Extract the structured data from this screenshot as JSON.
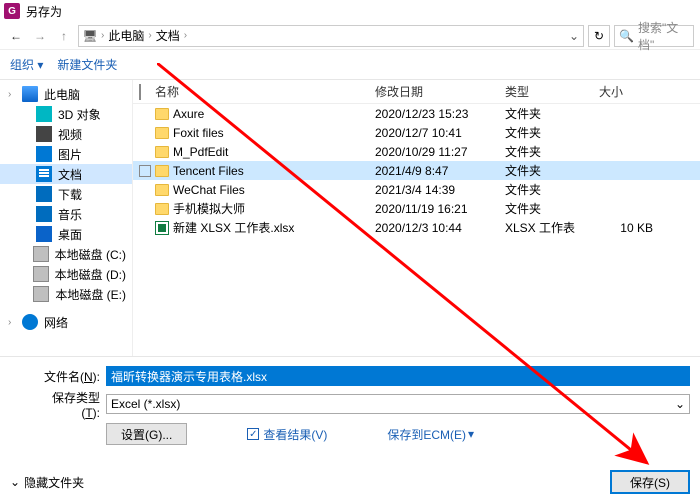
{
  "title": "另存为",
  "breadcrumb": {
    "root": "此电脑",
    "folder": "文档"
  },
  "search_placeholder": "搜索\"文档\"",
  "toolbar": {
    "organize": "组织 ▾",
    "newfolder": "新建文件夹"
  },
  "sidebar": [
    {
      "label": "此电脑",
      "icon": "i-pc",
      "sel": false,
      "indent": 8,
      "chevron": true
    },
    {
      "label": "3D 对象",
      "icon": "i-3d",
      "sel": false,
      "indent": 22
    },
    {
      "label": "视频",
      "icon": "i-vid",
      "sel": false,
      "indent": 22
    },
    {
      "label": "图片",
      "icon": "i-pic",
      "sel": false,
      "indent": 22
    },
    {
      "label": "文档",
      "icon": "i-doc",
      "sel": true,
      "indent": 22
    },
    {
      "label": "下载",
      "icon": "i-dl",
      "sel": false,
      "indent": 22
    },
    {
      "label": "音乐",
      "icon": "i-mus",
      "sel": false,
      "indent": 22
    },
    {
      "label": "桌面",
      "icon": "i-desk",
      "sel": false,
      "indent": 22
    },
    {
      "label": "本地磁盘 (C:)",
      "icon": "i-disk",
      "sel": false,
      "indent": 22
    },
    {
      "label": "本地磁盘 (D:)",
      "icon": "i-disk",
      "sel": false,
      "indent": 22
    },
    {
      "label": "本地磁盘 (E:)",
      "icon": "i-disk",
      "sel": false,
      "indent": 22
    },
    {
      "label": "网络",
      "icon": "i-net",
      "sel": false,
      "indent": 8,
      "chevron": true,
      "gap": true
    }
  ],
  "columns": {
    "name": "名称",
    "date": "修改日期",
    "type": "类型",
    "size": "大小"
  },
  "rows": [
    {
      "icon": "folder",
      "name": "Axure",
      "date": "2020/12/23 15:23",
      "type": "文件夹",
      "size": "",
      "sel": false
    },
    {
      "icon": "folder",
      "name": "Foxit files",
      "date": "2020/12/7 10:41",
      "type": "文件夹",
      "size": "",
      "sel": false
    },
    {
      "icon": "folder",
      "name": "M_PdfEdit",
      "date": "2020/10/29 11:27",
      "type": "文件夹",
      "size": "",
      "sel": false
    },
    {
      "icon": "folder",
      "name": "Tencent Files",
      "date": "2021/4/9 8:47",
      "type": "文件夹",
      "size": "",
      "sel": true
    },
    {
      "icon": "folder",
      "name": "WeChat Files",
      "date": "2021/3/4 14:39",
      "type": "文件夹",
      "size": "",
      "sel": false
    },
    {
      "icon": "folder",
      "name": "手机模拟大师",
      "date": "2020/11/19 16:21",
      "type": "文件夹",
      "size": "",
      "sel": false
    },
    {
      "icon": "xlsx",
      "name": "新建 XLSX 工作表.xlsx",
      "date": "2020/12/3 10:44",
      "type": "XLSX 工作表",
      "size": "10 KB",
      "sel": false
    }
  ],
  "filename_label": "文件名(N):",
  "filename_label_short": "文件名(",
  "filename_hotkey": "N",
  "filename_value": "福昕转换器演示专用表格.xlsx",
  "filetype_label_short": "保存类型(",
  "filetype_hotkey": "T",
  "filetype_value": "Excel (*.xlsx)",
  "settings_btn": "设置(G)...",
  "viewresult": "查看结果(V)",
  "save_ecm": "保存到ECM(E)",
  "hide_folders": "隐藏文件夹",
  "save_btn": "保存(S)"
}
